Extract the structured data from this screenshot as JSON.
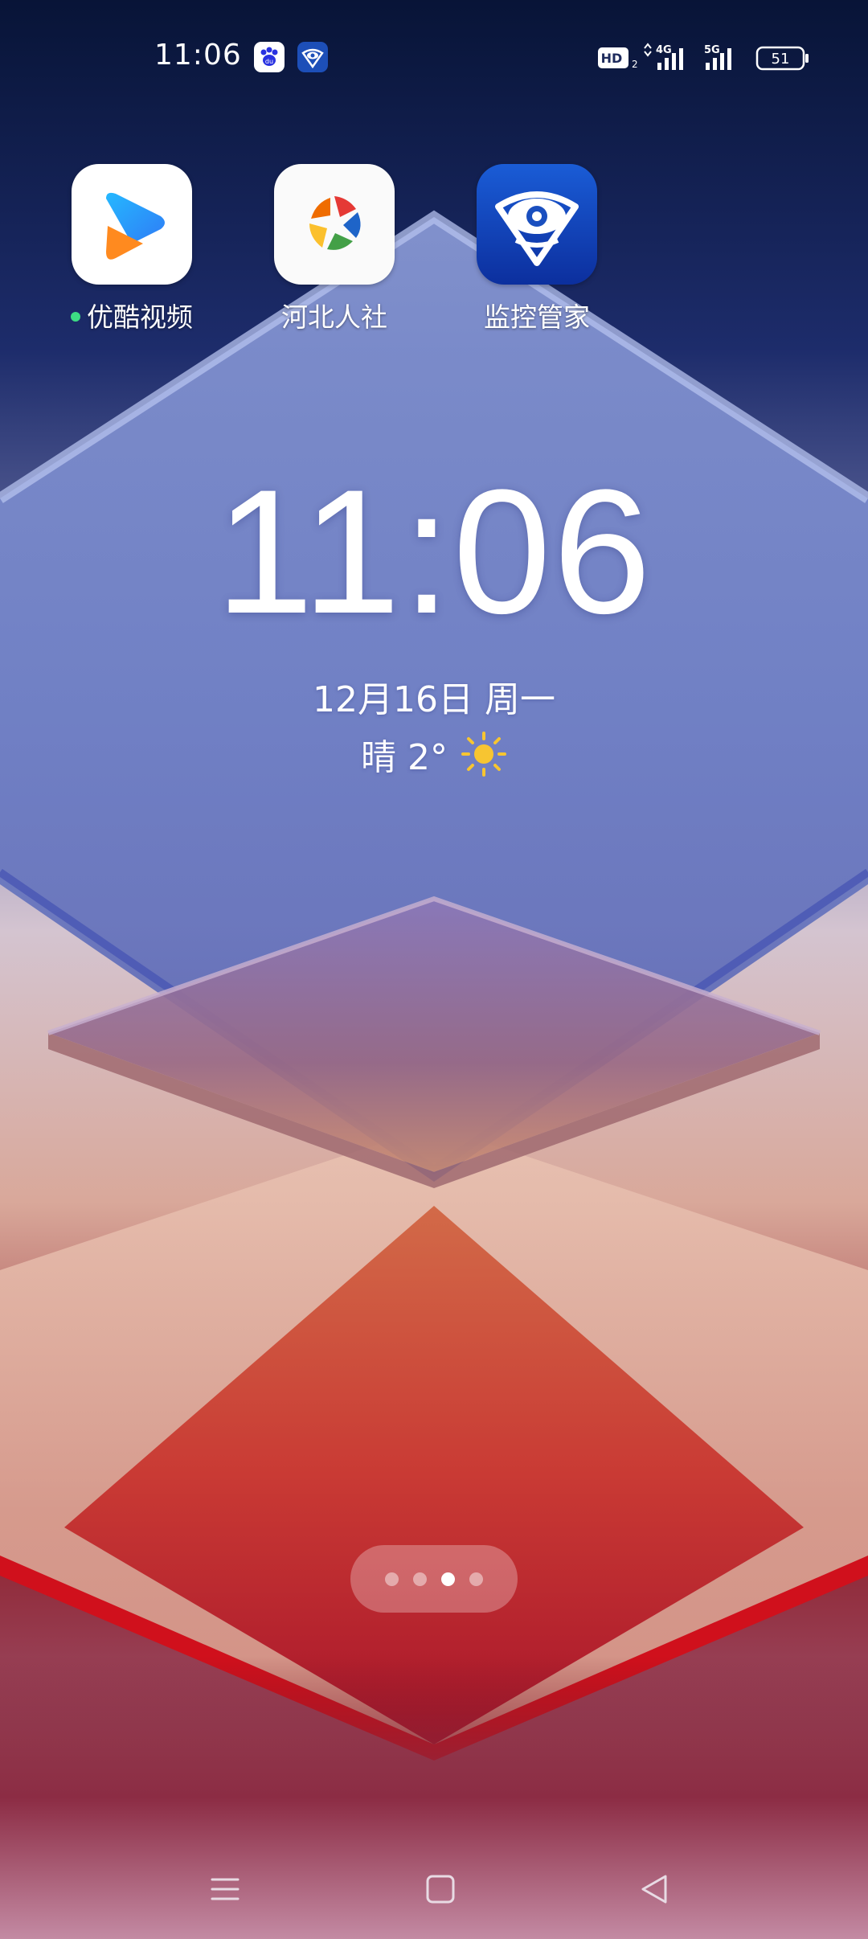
{
  "status_bar": {
    "time": "11:06",
    "notification_icons": [
      "baidu-icon",
      "monitor-eye-icon"
    ],
    "network_badges": {
      "hd": "HD",
      "hd_sub": "2",
      "sim1": "4G",
      "sim2": "5G"
    },
    "battery_level": "51"
  },
  "apps": [
    {
      "label": "优酷视频",
      "icon": "youku-icon",
      "has_new_dot": true
    },
    {
      "label": "河北人社",
      "icon": "hebei-hrss-icon",
      "has_new_dot": false
    },
    {
      "label": "监控管家",
      "icon": "monitor-eye-icon",
      "has_new_dot": false
    }
  ],
  "clock_widget": {
    "time": "11:06",
    "date": "12月16日  周一",
    "weather": "晴 2°",
    "weather_icon": "sun-icon"
  },
  "page_indicator": {
    "pages": 4,
    "active_index": 2
  },
  "nav_bar": {
    "icons": [
      "menu-icon",
      "home-icon",
      "back-icon"
    ]
  },
  "colors": {
    "sky_top": "#0b1740",
    "diamond_blue": "#6e7fc4",
    "peach": "#e2b09e",
    "red": "#c8202a",
    "accent_green": "#3ddc84",
    "sun_yellow": "#f7c531"
  }
}
